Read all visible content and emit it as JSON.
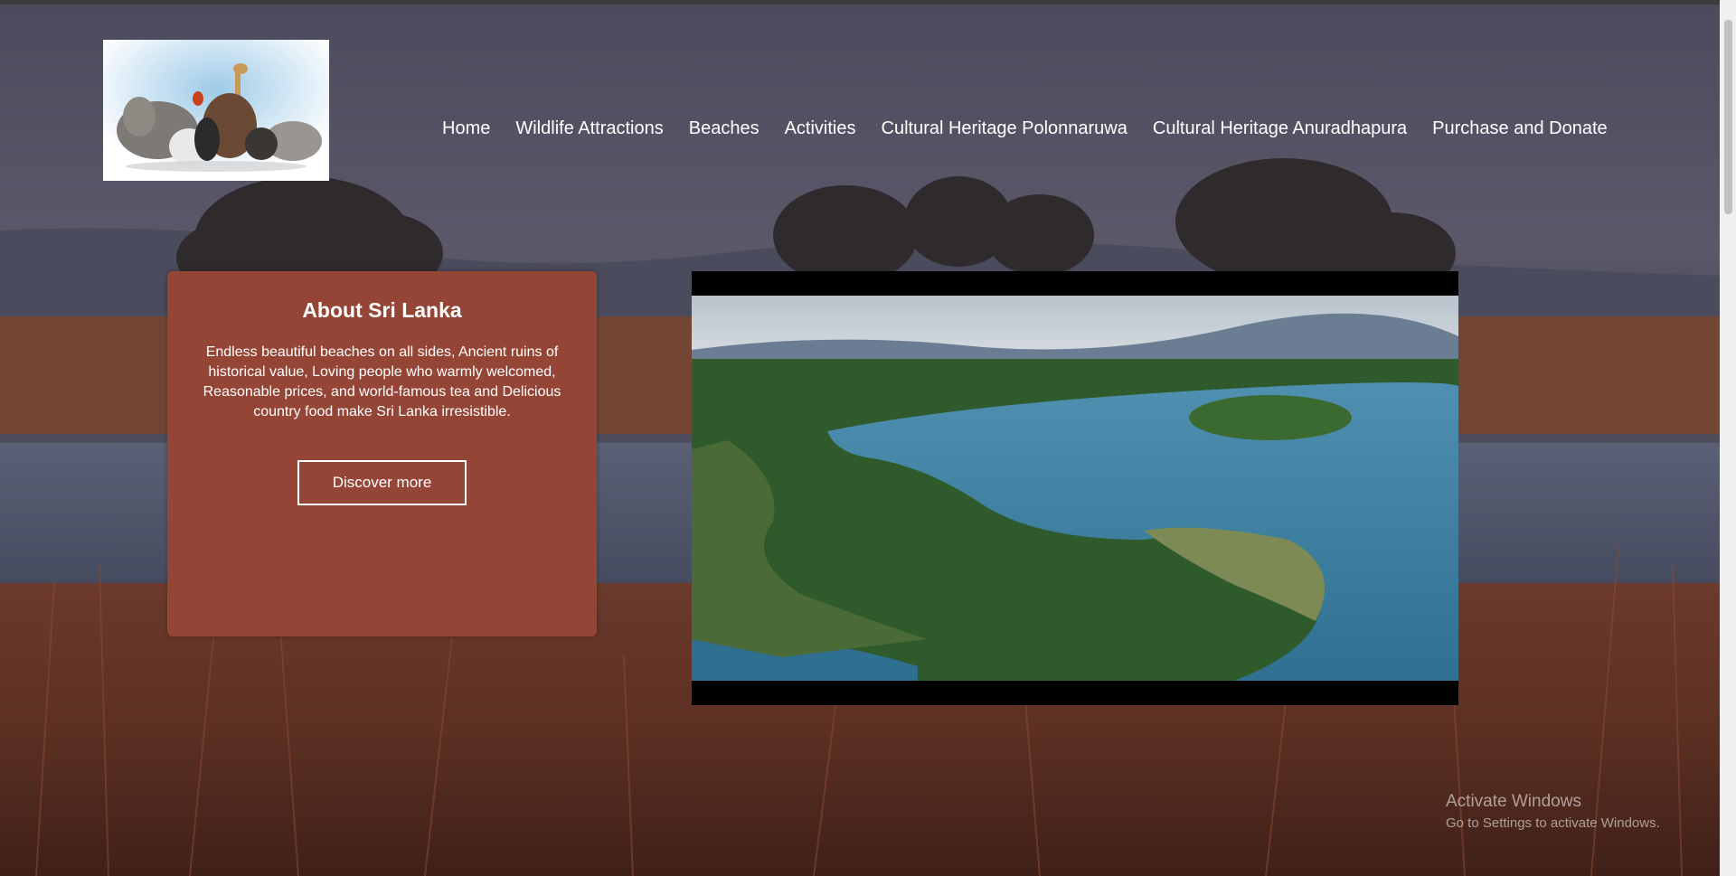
{
  "nav": {
    "items": [
      {
        "label": "Home"
      },
      {
        "label": "Wildlife Attractions"
      },
      {
        "label": "Beaches"
      },
      {
        "label": "Activities"
      },
      {
        "label": "Cultural Heritage Polonnaruwa"
      },
      {
        "label": "Cultural Heritage Anuradhapura"
      },
      {
        "label": "Purchase and Donate"
      }
    ]
  },
  "about": {
    "title": "About Sri Lanka",
    "body": "Endless beautiful beaches on all sides, Ancient ruins of historical value, Loving people who warmly welcomed, Reasonable prices, and world-famous tea and Delicious country food make Sri Lanka irresistible.",
    "button_label": "Discover more"
  },
  "watermark": {
    "title": "Activate Windows",
    "subtitle": "Go to Settings to activate Windows."
  },
  "colors": {
    "card_bg": "#954535",
    "nav_text": "#ffffff"
  }
}
